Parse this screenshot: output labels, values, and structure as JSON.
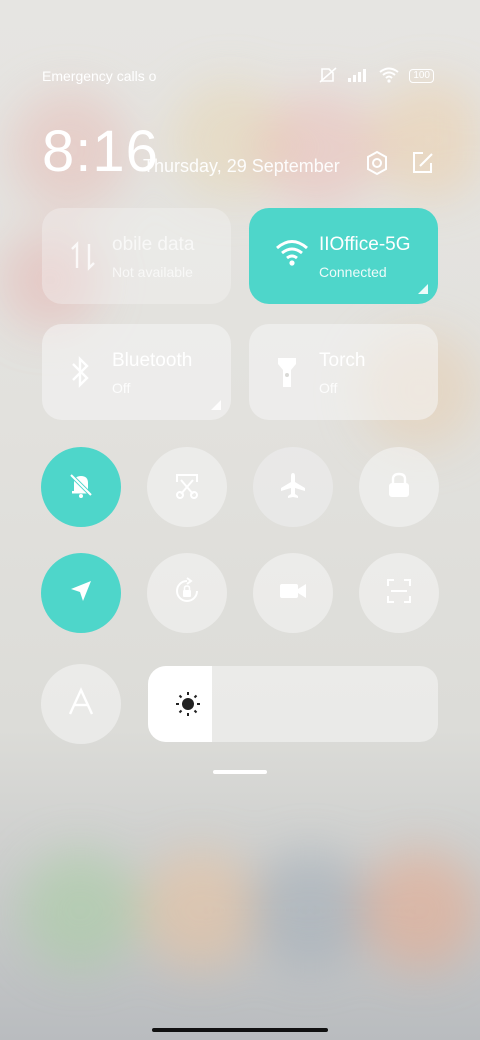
{
  "status": {
    "left_text": "Emergency calls o",
    "battery": "100"
  },
  "header": {
    "time": "8:16",
    "date": "Thursday, 29 September"
  },
  "tiles": [
    {
      "title": "obile data",
      "subtitle": "Not available",
      "state": "disabled"
    },
    {
      "title": "IIOffice-5G",
      "subtitle": "Connected",
      "state": "on"
    },
    {
      "title": "Bluetooth",
      "subtitle": "Off",
      "state": "off"
    },
    {
      "title": "Torch",
      "subtitle": "Off",
      "state": "off"
    }
  ],
  "toggles_row1": [
    {
      "name": "mute",
      "state": "on"
    },
    {
      "name": "screenshot",
      "state": "off"
    },
    {
      "name": "airplane",
      "state": "off"
    },
    {
      "name": "lock",
      "state": "off"
    }
  ],
  "toggles_row2": [
    {
      "name": "location",
      "state": "on"
    },
    {
      "name": "auto-rotate",
      "state": "off"
    },
    {
      "name": "screen-record",
      "state": "off"
    },
    {
      "name": "scan",
      "state": "off"
    }
  ],
  "brightness": {
    "level_fraction": 0.22
  },
  "colors": {
    "accent": "#4ed6ca"
  }
}
